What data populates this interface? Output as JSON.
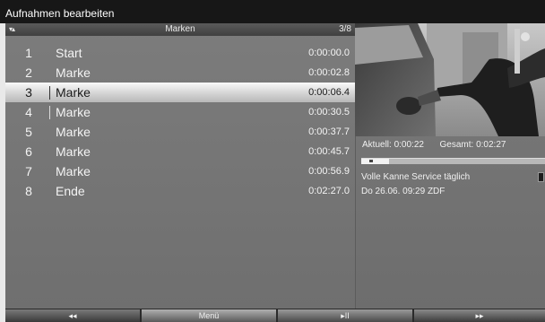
{
  "window": {
    "title": "Aufnahmen bearbeiten"
  },
  "list": {
    "header_arrows": "▾▴",
    "header_title": "Marken",
    "header_count": "3/8",
    "rows": [
      {
        "num": "1",
        "label": "Start",
        "time": "0:00:00.0"
      },
      {
        "num": "2",
        "label": "Marke",
        "time": "0:00:02.8"
      },
      {
        "num": "3",
        "label": "Marke",
        "time": "0:00:06.4"
      },
      {
        "num": "4",
        "label": "Marke",
        "time": "0:00:30.5"
      },
      {
        "num": "5",
        "label": "Marke",
        "time": "0:00:37.7"
      },
      {
        "num": "6",
        "label": "Marke",
        "time": "0:00:45.7"
      },
      {
        "num": "7",
        "label": "Marke",
        "time": "0:00:56.9"
      },
      {
        "num": "8",
        "label": "Ende",
        "time": "0:02:27.0"
      }
    ],
    "selected_index": 2
  },
  "info": {
    "current_label": "Aktuell:",
    "current_value": "0:00:22",
    "total_label": "Gesamt:",
    "total_value": "0:02:27",
    "progress_fraction": 0.15,
    "program_title": "Volle Kanne Service täglich",
    "program_meta": "Do 26.06. 09:29  ZDF"
  },
  "function_bar": {
    "rewind": "◂◂",
    "menu": "Menü",
    "play_pause": "▸II",
    "forward": "▸▸"
  },
  "colors": {
    "title_bar": "#171717",
    "panel": "#767676",
    "selection": "#e0e0e0"
  }
}
